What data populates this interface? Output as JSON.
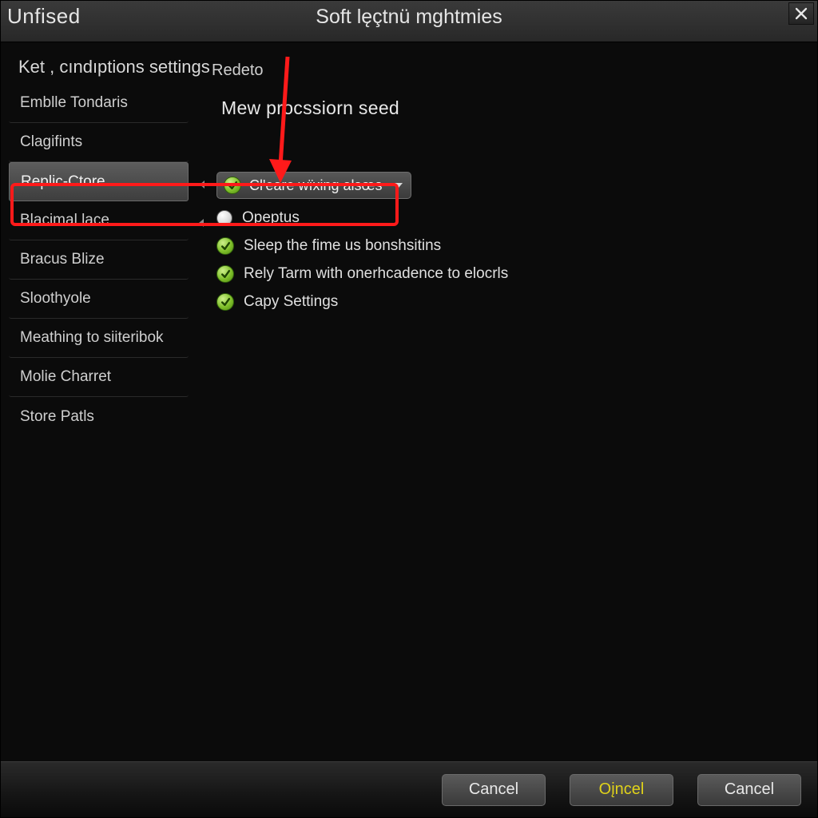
{
  "titlebar": {
    "left_label": "Unfised",
    "center_title": "Soft lęçtnü mghtmies"
  },
  "sidebar": {
    "group_title": "Ket , cındıptions settings",
    "items": [
      {
        "label": "Emblle Tondaris"
      },
      {
        "label": "Clagifints"
      },
      {
        "label": "Replic-Ctore"
      },
      {
        "label": "Blacimal lace"
      },
      {
        "label": "Bracus Blize"
      },
      {
        "label": "Sloothyole"
      },
      {
        "label": "Meathing to siiteribok"
      },
      {
        "label": "Molie Charret"
      },
      {
        "label": "Store Patls"
      }
    ],
    "selected_index": 2
  },
  "main": {
    "redeto_label": "Redeto",
    "heading": "Mew procssiorn seed",
    "dropdown_label": "Cl'eare wïxing alsœs",
    "options": [
      {
        "type": "radio",
        "label": "Opeptus"
      },
      {
        "type": "check",
        "label": "Sleep the fime us bonshsitins"
      },
      {
        "type": "check",
        "label": "Rely Tarm with onerhcadence to elocrls"
      },
      {
        "type": "check",
        "label": "Capy Settings"
      }
    ]
  },
  "footer": {
    "cancel1": "Cancel",
    "accent": "Oįncel",
    "cancel2": "Cancel"
  },
  "annotation": {
    "color": "#ff1a1a"
  }
}
